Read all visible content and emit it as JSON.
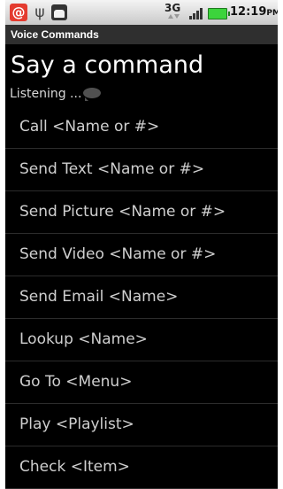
{
  "status_bar": {
    "network": "3G",
    "time": "12:19",
    "ampm": "PM",
    "icons": [
      "mail-notification-icon",
      "usb-icon",
      "android-icon",
      "signal-icon",
      "battery-icon"
    ]
  },
  "app": {
    "title": "Voice Commands"
  },
  "header": {
    "prompt": "Say a command",
    "status": "Listening ..."
  },
  "commands": [
    "Call <Name or #>",
    "Send Text <Name or #>",
    "Send Picture <Name or #>",
    "Send Video <Name or #>",
    "Send Email <Name>",
    "Lookup <Name>",
    "Go To <Menu>",
    "Play <Playlist>",
    "Check <Item>"
  ],
  "colors": {
    "background": "#000000",
    "title_bar": "#2f2f2f",
    "text": "#ffffff",
    "item_text": "#cfcfcf",
    "divider": "#2c2c2c",
    "battery": "#3cd43c",
    "mail_badge": "#e43b2f"
  }
}
